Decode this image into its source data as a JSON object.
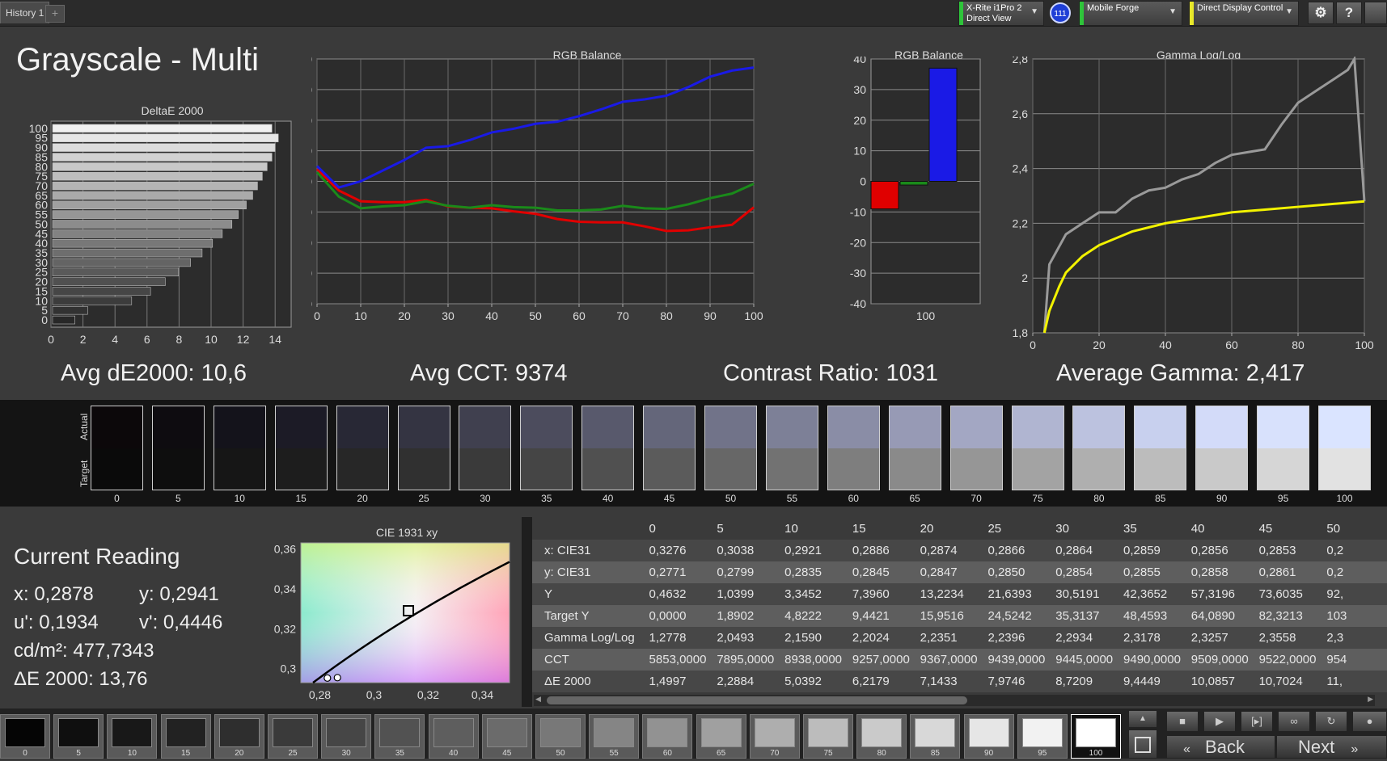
{
  "tabs": {
    "history_label": "History 1",
    "add_label": "+"
  },
  "toolbar": {
    "meter_label": "X-Rite i1Pro 2\nDirect View",
    "badge": "111",
    "profile_label": "Mobile Forge",
    "display_label": "Direct Display Control",
    "settings_icon": "gear-icon",
    "help_label": "?",
    "colors": {
      "meter_bar": "#2ec43a",
      "profile_bar": "#2ec43a",
      "display_bar": "#e8e82a"
    }
  },
  "page_title": "Grayscale - Multi",
  "summary": {
    "avg_de": "Avg dE2000: 10,6",
    "avg_cct": "Avg CCT: 9374",
    "contrast": "Contrast Ratio: 1031",
    "avg_gamma": "Average Gamma: 2,417"
  },
  "chart_data": [
    {
      "type": "bar",
      "title": "DeltaE 2000",
      "orientation": "horizontal",
      "categories": [
        "0",
        "5",
        "10",
        "15",
        "20",
        "25",
        "30",
        "35",
        "40",
        "45",
        "50",
        "55",
        "60",
        "65",
        "70",
        "75",
        "80",
        "85",
        "90",
        "95",
        "100"
      ],
      "category_tick_labels": [
        "0",
        "5",
        "10",
        "15",
        "20",
        "25",
        "30",
        "35",
        "40",
        "45",
        "50",
        "55",
        "60",
        "65",
        "70",
        "75",
        "80",
        "85",
        "90",
        "95",
        "100"
      ],
      "values": [
        1.5,
        2.29,
        5.04,
        6.22,
        7.14,
        7.97,
        8.72,
        9.44,
        10.09,
        10.7,
        11.3,
        11.7,
        12.2,
        12.6,
        12.9,
        13.2,
        13.5,
        13.8,
        14.0,
        14.2,
        13.8
      ],
      "xlim": [
        0,
        15
      ],
      "x_ticks": [
        "0",
        "2",
        "4",
        "6",
        "8",
        "10",
        "12",
        "14"
      ],
      "grid": true
    },
    {
      "type": "line",
      "title": "RGB Balance",
      "x": [
        0,
        5,
        10,
        15,
        20,
        25,
        30,
        35,
        40,
        45,
        50,
        55,
        60,
        65,
        70,
        75,
        80,
        85,
        90,
        95,
        100
      ],
      "series": [
        {
          "color": "#e00000",
          "values": [
            4,
            -3,
            -6.5,
            -6.8,
            -6.8,
            -6,
            -8.2,
            -8.6,
            -8.8,
            -9.8,
            -10.6,
            -12.3,
            -13.2,
            -13.4,
            -13.4,
            -14.7,
            -16.2,
            -16,
            -15,
            -14.2,
            -8.5
          ]
        },
        {
          "color": "#1a8a1a",
          "values": [
            3,
            -5,
            -8.8,
            -8.2,
            -7.8,
            -6.5,
            -8,
            -8.6,
            -7.8,
            -8.4,
            -8.6,
            -9.5,
            -9.5,
            -9.2,
            -8,
            -8.8,
            -9,
            -7.5,
            -5.5,
            -4,
            -0.8
          ]
        },
        {
          "color": "#1a1ae6",
          "values": [
            5,
            -2,
            0,
            3.5,
            7,
            11,
            11.5,
            13.5,
            16,
            17.2,
            18.8,
            19.5,
            21.3,
            23.5,
            26,
            26.8,
            28,
            30.8,
            34.2,
            36.2,
            37.2
          ]
        }
      ],
      "ylim": [
        -40,
        40
      ],
      "y_ticks": [
        "40",
        "30",
        "20",
        "10",
        "0",
        "-10",
        "-20",
        "-30",
        "-40"
      ],
      "x_ticks": [
        "0",
        "10",
        "20",
        "30",
        "40",
        "50",
        "60",
        "70",
        "80",
        "90",
        "100"
      ],
      "grid": true
    },
    {
      "type": "bar",
      "title": "RGB Balance",
      "categories": [
        "100"
      ],
      "series": [
        {
          "color": "#e00000",
          "values": [
            -9
          ]
        },
        {
          "color": "#1a8a1a",
          "values": [
            -1.2
          ]
        },
        {
          "color": "#1a1ae6",
          "values": [
            37
          ]
        }
      ],
      "ylim": [
        -40,
        40
      ],
      "y_ticks": [
        "40",
        "30",
        "20",
        "10",
        "0",
        "-10",
        "-20",
        "-30",
        "-40"
      ],
      "x_ticks": [
        "100"
      ],
      "grid": true
    },
    {
      "type": "line",
      "title": "Gamma Log/Log",
      "x": [
        2.5,
        5,
        10,
        15,
        20,
        25,
        30,
        35,
        40,
        45,
        50,
        55,
        60,
        65,
        70,
        75,
        80,
        85,
        90,
        95,
        97,
        100
      ],
      "series": [
        {
          "color": "#9a9a9a",
          "x": [
            3.5,
            5,
            10,
            15,
            20,
            25,
            30,
            35,
            40,
            45,
            50,
            55,
            60,
            65,
            70,
            75,
            80,
            85,
            90,
            95,
            97,
            100
          ],
          "values": [
            1.8,
            2.05,
            2.16,
            2.2,
            2.24,
            2.24,
            2.29,
            2.32,
            2.33,
            2.36,
            2.38,
            2.42,
            2.45,
            2.46,
            2.47,
            2.56,
            2.64,
            2.68,
            2.72,
            2.76,
            2.8,
            2.28
          ]
        },
        {
          "color": "#f2f200",
          "x": [
            3.5,
            5,
            8,
            10,
            15,
            20,
            30,
            40,
            50,
            60,
            70,
            80,
            90,
            100
          ],
          "values": [
            1.8,
            1.88,
            1.97,
            2.02,
            2.08,
            2.12,
            2.17,
            2.2,
            2.22,
            2.24,
            2.25,
            2.26,
            2.27,
            2.28
          ]
        }
      ],
      "ylim": [
        1.8,
        2.8
      ],
      "xlim": [
        0,
        100
      ],
      "y_ticks": [
        "2,8",
        "2,6",
        "2,4",
        "2,2",
        "2",
        "1,8"
      ],
      "x_ticks": [
        "0",
        "20",
        "40",
        "60",
        "80",
        "100"
      ],
      "grid": true
    },
    {
      "type": "scatter",
      "title": "CIE 1931 xy",
      "points": [
        {
          "x": 0.2828,
          "y": 0.2953
        },
        {
          "x": 0.2865,
          "y": 0.2955
        }
      ],
      "target_square": {
        "x": 0.3127,
        "y": 0.329
      },
      "xlim": [
        0.273,
        0.35
      ],
      "ylim": [
        0.293,
        0.363
      ],
      "x_ticks": [
        "0,28",
        "0,3",
        "0,32",
        "0,34"
      ],
      "y_ticks": [
        "0,36",
        "0,34",
        "0,32",
        "0,3"
      ]
    }
  ],
  "swatches": {
    "actual_label": "Actual",
    "target_label": "Target",
    "items": [
      {
        "label": "0",
        "actual": "#0c080a",
        "target": "#0a0a0a"
      },
      {
        "label": "5",
        "actual": "#0e0c10",
        "target": "#0e0e0e"
      },
      {
        "label": "10",
        "actual": "#14131b",
        "target": "#161616"
      },
      {
        "label": "15",
        "actual": "#1c1b26",
        "target": "#1d1d1d"
      },
      {
        "label": "20",
        "actual": "#282835",
        "target": "#272727"
      },
      {
        "label": "25",
        "actual": "#343442",
        "target": "#303030"
      },
      {
        "label": "30",
        "actual": "#40404f",
        "target": "#3a3a3a"
      },
      {
        "label": "35",
        "actual": "#4c4c5d",
        "target": "#454545"
      },
      {
        "label": "40",
        "actual": "#58596c",
        "target": "#505050"
      },
      {
        "label": "45",
        "actual": "#64667a",
        "target": "#5b5b5b"
      },
      {
        "label": "50",
        "actual": "#717389",
        "target": "#676767"
      },
      {
        "label": "55",
        "actual": "#7d8097",
        "target": "#727272"
      },
      {
        "label": "60",
        "actual": "#8a8da6",
        "target": "#7e7e7e"
      },
      {
        "label": "65",
        "actual": "#979ab5",
        "target": "#8a8a8a"
      },
      {
        "label": "70",
        "actual": "#a3a7c3",
        "target": "#969696"
      },
      {
        "label": "75",
        "actual": "#b0b5d1",
        "target": "#a3a3a3"
      },
      {
        "label": "80",
        "actual": "#bcc2df",
        "target": "#afafaf"
      },
      {
        "label": "85",
        "actual": "#c8d0ee",
        "target": "#bcbcbc"
      },
      {
        "label": "90",
        "actual": "#d3dbf9",
        "target": "#c9c9c9"
      },
      {
        "label": "95",
        "actual": "#d8e1fc",
        "target": "#d6d6d6"
      },
      {
        "label": "100",
        "actual": "#dae4ff",
        "target": "#e2e2e2"
      }
    ]
  },
  "reading": {
    "title": "Current Reading",
    "x": "x: 0,2878",
    "y": "y: 0,2941",
    "u": "u': 0,1934",
    "v": "v': 0,4446",
    "cd": "cd/m²: 477,7343",
    "de": "ΔE 2000: 13,76"
  },
  "table": {
    "columns": [
      "0",
      "5",
      "10",
      "15",
      "20",
      "25",
      "30",
      "35",
      "40",
      "45",
      "50"
    ],
    "rows": [
      {
        "label": "x: CIE31",
        "values": [
          "0,3276",
          "0,3038",
          "0,2921",
          "0,2886",
          "0,2874",
          "0,2866",
          "0,2864",
          "0,2859",
          "0,2856",
          "0,2853",
          "0,2"
        ]
      },
      {
        "label": "y: CIE31",
        "values": [
          "0,2771",
          "0,2799",
          "0,2835",
          "0,2845",
          "0,2847",
          "0,2850",
          "0,2854",
          "0,2855",
          "0,2858",
          "0,2861",
          "0,2"
        ]
      },
      {
        "label": "Y",
        "values": [
          "0,4632",
          "1,0399",
          "3,3452",
          "7,3960",
          "13,2234",
          "21,6393",
          "30,5191",
          "42,3652",
          "57,3196",
          "73,6035",
          "92,"
        ]
      },
      {
        "label": "Target Y",
        "values": [
          "0,0000",
          "1,8902",
          "4,8222",
          "9,4421",
          "15,9516",
          "24,5242",
          "35,3137",
          "48,4593",
          "64,0890",
          "82,3213",
          "103"
        ]
      },
      {
        "label": "Gamma Log/Log",
        "values": [
          "1,2778",
          "2,0493",
          "2,1590",
          "2,2024",
          "2,2351",
          "2,2396",
          "2,2934",
          "2,3178",
          "2,3257",
          "2,3558",
          "2,3"
        ]
      },
      {
        "label": "CCT",
        "values": [
          "5853,0000",
          "7895,0000",
          "8938,0000",
          "9257,0000",
          "9367,0000",
          "9439,0000",
          "9445,0000",
          "9490,0000",
          "9509,0000",
          "9522,0000",
          "954"
        ]
      },
      {
        "label": "ΔE 2000",
        "values": [
          "1,4997",
          "2,2884",
          "5,0392",
          "6,2179",
          "7,1433",
          "7,9746",
          "8,7209",
          "9,4449",
          "10,0857",
          "10,7024",
          "11,"
        ]
      }
    ]
  },
  "patch_bar": {
    "items": [
      {
        "label": "0",
        "color": "#050505"
      },
      {
        "label": "5",
        "color": "#0f0f0f"
      },
      {
        "label": "10",
        "color": "#181818"
      },
      {
        "label": "15",
        "color": "#222222"
      },
      {
        "label": "20",
        "color": "#2e2e2e"
      },
      {
        "label": "25",
        "color": "#3a3a3a"
      },
      {
        "label": "30",
        "color": "#464646"
      },
      {
        "label": "35",
        "color": "#525252"
      },
      {
        "label": "40",
        "color": "#5e5e5e"
      },
      {
        "label": "45",
        "color": "#6b6b6b"
      },
      {
        "label": "50",
        "color": "#787878"
      },
      {
        "label": "55",
        "color": "#858585"
      },
      {
        "label": "60",
        "color": "#929292"
      },
      {
        "label": "65",
        "color": "#a0a0a0"
      },
      {
        "label": "70",
        "color": "#aeaeae"
      },
      {
        "label": "75",
        "color": "#bcbcbc"
      },
      {
        "label": "80",
        "color": "#cacaca"
      },
      {
        "label": "85",
        "color": "#d8d8d8"
      },
      {
        "label": "90",
        "color": "#e6e6e6"
      },
      {
        "label": "95",
        "color": "#f2f2f2"
      },
      {
        "label": "100",
        "color": "#ffffff"
      }
    ],
    "selected": "100",
    "back_label": "Back",
    "next_label": "Next"
  }
}
